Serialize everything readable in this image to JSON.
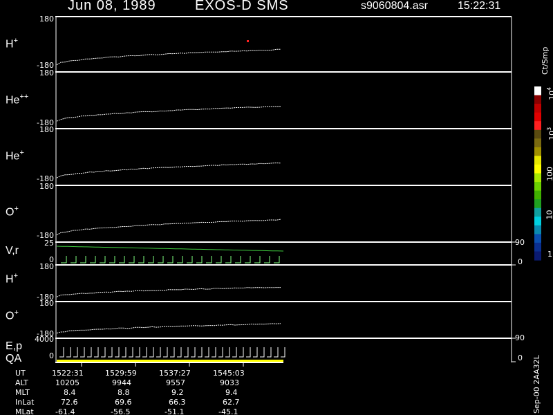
{
  "header": {
    "date": "Jun 08, 1989",
    "instrument": "EXOS-D SMS",
    "file": "s9060804.asr",
    "time": "15:22:31"
  },
  "panels": [
    {
      "base": "H",
      "sup": "+",
      "top": "180",
      "bottom": "-180"
    },
    {
      "base": "He",
      "sup": "++",
      "top": "180",
      "bottom": "-180"
    },
    {
      "base": "He",
      "sup": "+",
      "top": "180",
      "bottom": "-180"
    },
    {
      "base": "O",
      "sup": "+",
      "top": "180",
      "bottom": "-180"
    },
    {
      "base": "V,r",
      "sup": "",
      "top": "25",
      "bottom": "0",
      "right_top": "90",
      "right_bottom": "0"
    },
    {
      "base": "H",
      "sup": "+",
      "top": "180",
      "bottom": "-180"
    },
    {
      "base": "O",
      "sup": "+",
      "top": "180",
      "bottom": "-180"
    },
    {
      "base": "E,p",
      "sup": "",
      "base2": "QA",
      "top": "4000",
      "bottom": "0",
      "right_top": "90",
      "right_bottom": "0"
    }
  ],
  "colorbar": {
    "unit": "Ct/Smp",
    "labels": [
      "10",
      "10",
      "100",
      "10",
      "1"
    ],
    "exponents": [
      "4",
      "3",
      "",
      "",
      ""
    ],
    "colors": [
      "#ffffff",
      "#8b0000",
      "#c00000",
      "#e00000",
      "#ff2020",
      "#5a4a10",
      "#7a6a10",
      "#a09000",
      "#e8e800",
      "#ffff00",
      "#a8e800",
      "#6cd000",
      "#40b000",
      "#20a020",
      "#10a0a0",
      "#00d0e0",
      "#0a8ab0",
      "#0a4fb0",
      "#0a2f90",
      "#0a1a70"
    ]
  },
  "footer": {
    "row_labels": [
      "UT",
      "ALT",
      "MLT",
      "InLat",
      "MLat"
    ],
    "columns": [
      [
        "1522:31",
        "10205",
        "8.4",
        "72.6",
        "-61.4"
      ],
      [
        "1529:59",
        "9944",
        "8.8",
        "69.6",
        "-56.5"
      ],
      [
        "1537:27",
        "9557",
        "9.2",
        "66.3",
        "-51.1"
      ],
      [
        "1545:03",
        "9033",
        "9.4",
        "62.7",
        "-45.1"
      ]
    ],
    "version": "Sep-00  2AA32L"
  },
  "chart_data": {
    "type": "heatmap",
    "title": "Jun 08, 1989   EXOS-D SMS",
    "x": [
      "1522:31",
      "1529:59",
      "1537:27",
      "1545:03"
    ],
    "series": [
      {
        "name": "H+",
        "ylim": [
          -180,
          180
        ]
      },
      {
        "name": "He++",
        "ylim": [
          -180,
          180
        ]
      },
      {
        "name": "He+",
        "ylim": [
          -180,
          180
        ]
      },
      {
        "name": "O+",
        "ylim": [
          -180,
          180
        ]
      },
      {
        "name": "V,r",
        "ylim": [
          0,
          25
        ],
        "right_ylim": [
          0,
          90
        ]
      },
      {
        "name": "H+",
        "ylim": [
          -180,
          180
        ]
      },
      {
        "name": "O+",
        "ylim": [
          -180,
          180
        ]
      },
      {
        "name": "E,p QA",
        "ylim": [
          0,
          4000
        ],
        "right_ylim": [
          0,
          90
        ]
      }
    ],
    "colorscale": {
      "label": "Ct/Smp",
      "ticks": [
        1,
        10,
        100,
        1000,
        10000
      ]
    }
  }
}
